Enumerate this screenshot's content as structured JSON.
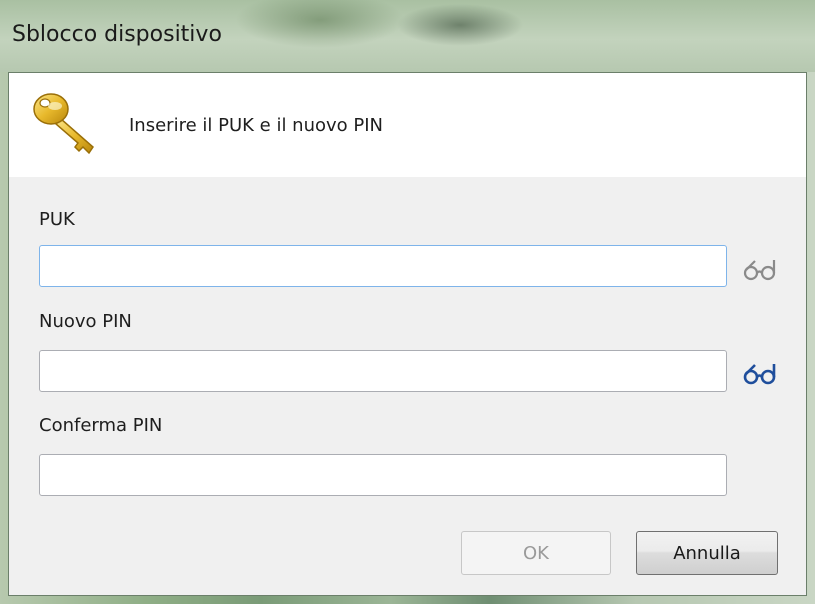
{
  "window": {
    "title": "Sblocco dispositivo"
  },
  "header": {
    "icon": "key-icon",
    "instruction": "Inserire il PUK e il nuovo PIN"
  },
  "form": {
    "puk": {
      "label": "PUK",
      "value": "",
      "reveal_icon": "glasses-icon"
    },
    "new_pin": {
      "label": "Nuovo PIN",
      "value": "",
      "reveal_icon": "glasses-icon"
    },
    "confirm_pin": {
      "label": "Conferma PIN",
      "value": ""
    }
  },
  "buttons": {
    "ok_label": "OK",
    "ok_enabled": false,
    "cancel_label": "Annulla"
  },
  "colors": {
    "reveal_icon_active": "#1f4e9c",
    "reveal_icon_inactive": "#8a8a8a",
    "focus_border": "#7eb4ea",
    "key_gold": "#e8b92c"
  }
}
